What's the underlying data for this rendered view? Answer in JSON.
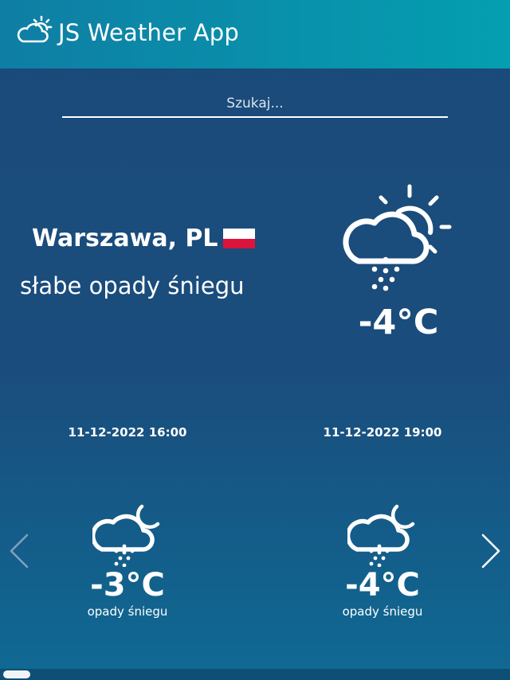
{
  "header": {
    "title": "JS Weather App",
    "logo_icon": "cloud-sun-icon"
  },
  "search": {
    "placeholder": "Szukaj..."
  },
  "current": {
    "city": "Warszawa, PL",
    "country_flag": "flag-pl",
    "description": "słabe opady śniegu",
    "temperature": "-4°C",
    "icon": "snow-cloud-sun-icon"
  },
  "forecast": [
    {
      "datetime": "11-12-2022 16:00",
      "temperature": "-3°C",
      "description": "opady śniegu",
      "icon": "snow-cloud-moon-icon"
    },
    {
      "datetime": "11-12-2022 19:00",
      "temperature": "-4°C",
      "description": "opady śniegu",
      "icon": "snow-cloud-moon-icon"
    }
  ],
  "controls": {
    "prev_icon": "chevron-left-icon",
    "next_icon": "chevron-right-icon"
  },
  "colors": {
    "header_start": "#0f7ea4",
    "header_end": "#049fb0",
    "background": "#1a4a7a",
    "flag_red": "#dc143c"
  }
}
